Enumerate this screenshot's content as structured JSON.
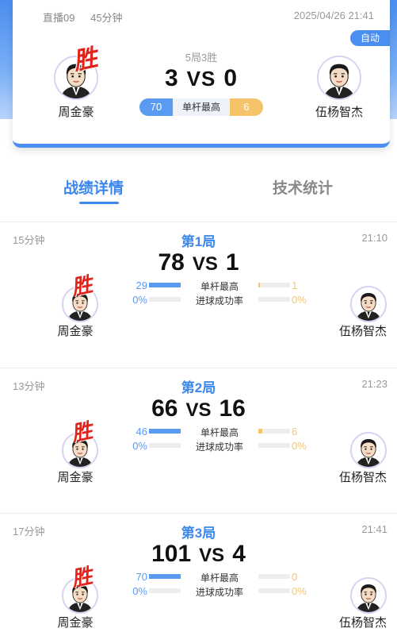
{
  "header": {
    "channel": "直播09",
    "duration": "45分钟",
    "datetime": "2025/04/26 21:41",
    "mode_badge": "自动"
  },
  "summary": {
    "format": "5局3胜",
    "left_player": "周金豪",
    "right_player": "伍杨智杰",
    "left_score": "3",
    "vs": "VS",
    "right_score": "0",
    "win_label": "胜",
    "highest_break_label": "单杆最高",
    "left_highest_break": "70",
    "right_highest_break": "6"
  },
  "tabs": [
    {
      "label": "战绩详情",
      "active": true
    },
    {
      "label": "技术统计",
      "active": false
    }
  ],
  "stat_labels": {
    "highest_break": "单杆最高",
    "pot_success": "进球成功率"
  },
  "frames": [
    {
      "title": "第1局",
      "duration": "15分钟",
      "time": "21:10",
      "left_score": "78",
      "vs": "VS",
      "right_score": "1",
      "left_player": "周金豪",
      "right_player": "伍杨智杰",
      "win_label": "胜",
      "left_break": "29",
      "right_break": "1",
      "left_break_frac": 1.0,
      "right_break_frac": 0.05,
      "left_pot": "0%",
      "right_pot": "0%"
    },
    {
      "title": "第2局",
      "duration": "13分钟",
      "time": "21:23",
      "left_score": "66",
      "vs": "VS",
      "right_score": "16",
      "left_player": "周金豪",
      "right_player": "伍杨智杰",
      "win_label": "胜",
      "left_break": "46",
      "right_break": "6",
      "left_break_frac": 1.0,
      "right_break_frac": 0.13,
      "left_pot": "0%",
      "right_pot": "0%"
    },
    {
      "title": "第3局",
      "duration": "17分钟",
      "time": "21:41",
      "left_score": "101",
      "vs": "VS",
      "right_score": "4",
      "left_player": "周金豪",
      "right_player": "伍杨智杰",
      "win_label": "胜",
      "left_break": "70",
      "right_break": "0",
      "left_break_frac": 1.0,
      "right_break_frac": 0.0,
      "left_pot": "0%",
      "right_pot": "0%"
    }
  ],
  "colors": {
    "accent": "#3b87ee",
    "left_bar": "#5a9bf2",
    "right_bar": "#f5c46a",
    "win": "#e0241b"
  },
  "icons": {
    "avatar": "cartoon-player-avatar-icon"
  }
}
